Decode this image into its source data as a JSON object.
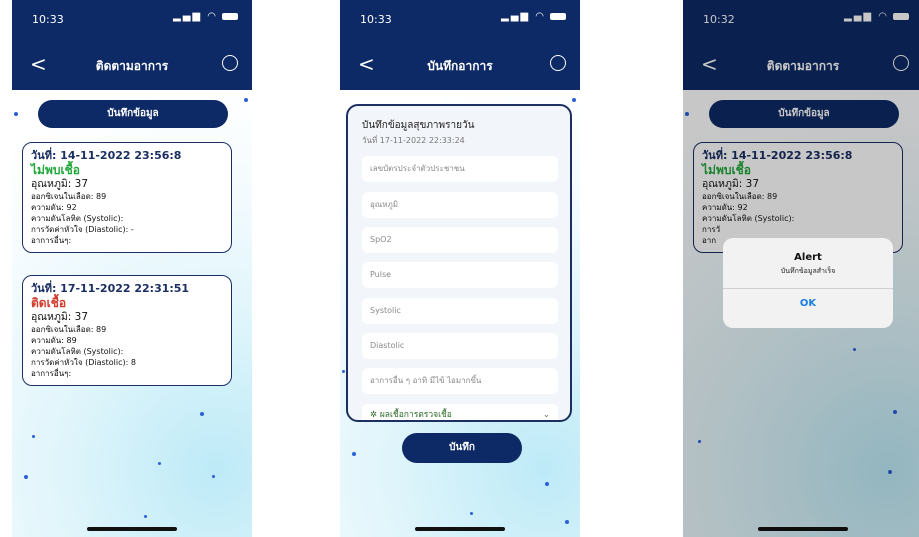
{
  "screens": [
    {
      "status_time": "10:33",
      "nav_title": "ติดตามอาการ",
      "top_button": "บันทึกข้อมูล",
      "records": [
        {
          "date": "วันที่: 14-11-2022 23:56:8",
          "status": "ไม่พบเชื้อ",
          "temp": "อุณหภูมิ: 37",
          "oxygen": "ออกซิเจนในเลือด: 89",
          "pressure": "ความดัน: 92",
          "systolic": "ความดันโลหิต (Systolic):",
          "diastolic": "การวัดค่าหัวใจ (Diastolic): -",
          "other": "อาการอื่นๆ:"
        },
        {
          "date": "วันที่: 17-11-2022 22:31:51",
          "status": "ติดเชื้อ",
          "temp": "อุณหภูมิ: 37",
          "oxygen": "ออกซิเจนในเลือด: 89",
          "pressure": "ความดัน: 89",
          "systolic": "ความดันโลหิต (Systolic):",
          "diastolic": "การวัดค่าหัวใจ (Diastolic): 8",
          "other": "อาการอื่นๆ:"
        }
      ]
    },
    {
      "status_time": "10:33",
      "nav_title": "บันทึกอาการ",
      "form_title": "บันทึกข้อมูลสุขภาพรายวัน",
      "form_date": "วันที่ 17-11-2022 22:33:24",
      "placeholders": {
        "id_card": "เลขบัตรประจำตัวประชาชน",
        "temperature": "อุณหภูมิ",
        "spo2": "SpO2",
        "pulse": "Pulse",
        "systolic": "Systolic",
        "diastolic": "Diastolic",
        "other": "อาการอื่น ๆ อาทิ มีไข้ ไอมากขึ้น"
      },
      "select_label": "ผลเชื้อการตรวจเชื้อ",
      "save_button": "บันทึก"
    },
    {
      "status_time": "10:32",
      "nav_title": "ติดตามอาการ",
      "top_button": "บันทึกข้อมูล",
      "record": {
        "date": "วันที่: 14-11-2022 23:56:8",
        "status": "ไม่พบเชื้อ",
        "temp": "อุณหภูมิ: 37",
        "oxygen": "ออกซิเจนในเลือด: 89",
        "pressure": "ความดัน: 92",
        "systolic": "ความดันโลหิต (Systolic):",
        "diastolic_partial": "การวั",
        "other_partial": "อาก"
      },
      "alert": {
        "title": "Alert",
        "message": "บันทึกข้อมูลสำเร็จ",
        "ok": "OK"
      }
    }
  ],
  "colors": {
    "nav": "#0d2a66",
    "negative": "#22a83a",
    "positive": "#d23a2a",
    "dots": "#2b5fd8",
    "ok": "#1a7de0"
  }
}
